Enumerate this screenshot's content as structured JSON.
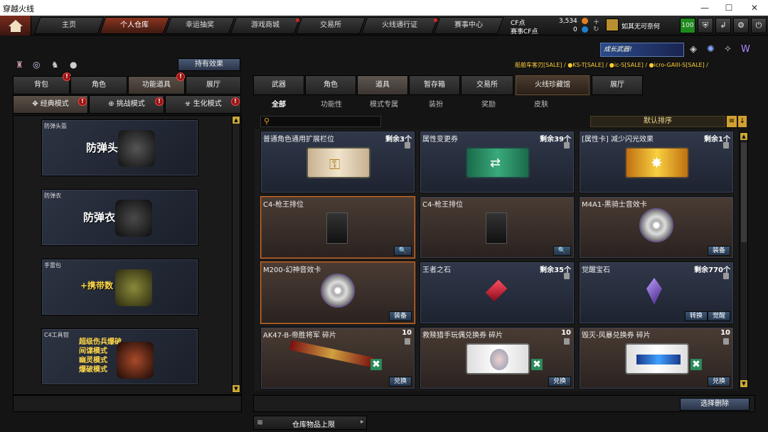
{
  "window": {
    "title": "穿越火线",
    "minimize": "—",
    "maximize": "☐",
    "close": "✕"
  },
  "nav": {
    "tabs": [
      "主页",
      "个人仓库",
      "幸运抽奖",
      "游戏商城",
      "交易所",
      "火线通行证",
      "赛事中心"
    ],
    "active_index": 1,
    "currency": [
      {
        "label": "CF点",
        "value": "3,534"
      },
      {
        "label": "赛事CF点",
        "value": "0"
      }
    ],
    "level_badge": "100",
    "user_name": "如其无可奈何"
  },
  "banner": {
    "promo": "成长武器!",
    "ticker": "船舶车客刃[SALE] / ●KS-T[SALE] / ●ic-S[SALE] / ●icro-GAIII-S[SALE] /"
  },
  "left": {
    "have_effect": "持有效果",
    "tabs": [
      "背包",
      "角色",
      "功能道具",
      "展厅"
    ],
    "active_tab": 2,
    "modes": [
      "经典模式",
      "挑战模式",
      "生化模式"
    ],
    "active_mode": 0,
    "cards": [
      {
        "caption": "防弹头盔",
        "title": "防弹头盔"
      },
      {
        "caption": "防弹衣",
        "title": "防弹衣"
      },
      {
        "caption": "手雷包",
        "title": "+携带数"
      },
      {
        "caption": "C4工具钳",
        "lines": [
          "超级伤兵爆破",
          "间谍模式",
          "幽灵模式",
          "爆破模式"
        ]
      }
    ]
  },
  "right": {
    "tabs": [
      "武器",
      "角色",
      "道具",
      "暂存箱",
      "交易所",
      "火线珍藏馆",
      "展厅"
    ],
    "active_tab": 2,
    "subtabs": [
      "全部",
      "功能性",
      "模式专属",
      "装扮",
      "奖励",
      "皮肤"
    ],
    "active_subtab": 0,
    "search_placeholder": "",
    "sort_label": "默认排序",
    "items": [
      {
        "name": "普通角色通用扩展栏位",
        "count": "剩余3个"
      },
      {
        "name": "属性变更券",
        "count": "剩余39个"
      },
      {
        "name": "[属性卡] 减少闪光效果",
        "count": "剩余1个"
      },
      {
        "name": "C4-枪王排位",
        "count": "",
        "button": "🔍"
      },
      {
        "name": "C4-枪王排位",
        "count": "",
        "button": "🔍"
      },
      {
        "name": "M4A1-黑骑士音效卡",
        "count": "",
        "button": "装备"
      },
      {
        "name": "M200-幻神音效卡",
        "count": "",
        "button": "装备"
      },
      {
        "name": "王者之石",
        "count": "剩余35个"
      },
      {
        "name": "觉醒宝石",
        "count": "剩余770个",
        "buttons": [
          "转换",
          "觉醒"
        ]
      },
      {
        "name": "AK47-B-帝胜将军 碎片",
        "count": "10",
        "button": "兑换"
      },
      {
        "name": "救赎猎手玩偶兑换券 碎片",
        "count": "10",
        "button": "兑换"
      },
      {
        "name": "毁灭-风暴兑换券 碎片",
        "count": "10",
        "button": "兑换"
      }
    ],
    "select_delete": "选择删除",
    "warehouse_limit": "仓库物品上限"
  },
  "colors": {
    "accent": "#c8702a",
    "button_blue": "#2c4866",
    "scroll_gold": "#caa83a",
    "active_tab": "#8a3420"
  }
}
